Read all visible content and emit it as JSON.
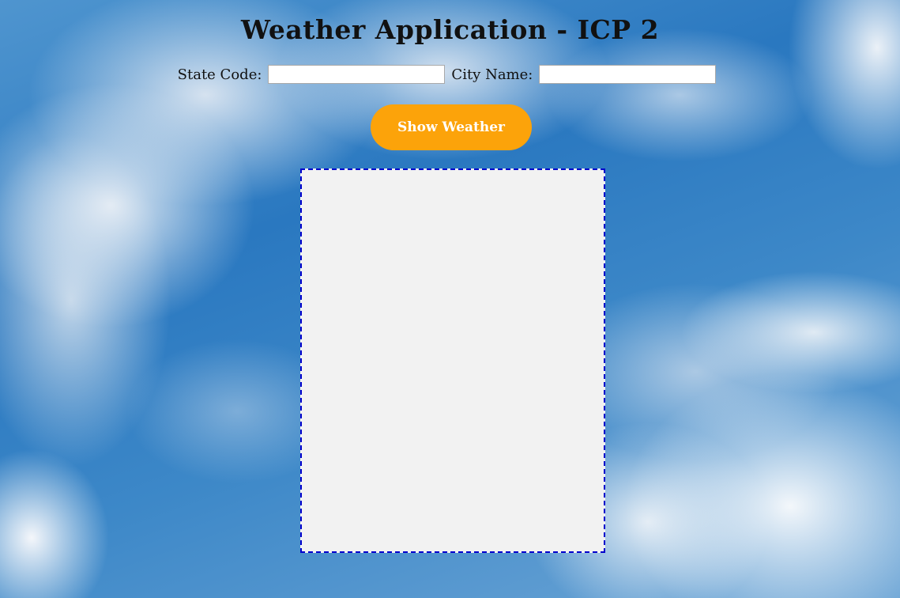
{
  "page": {
    "title": "Weather Application - ICP 2"
  },
  "form": {
    "state_label": "State Code:",
    "state_value": "",
    "city_label": "City Name:",
    "city_value": ""
  },
  "actions": {
    "show_label": "Show Weather"
  },
  "colors": {
    "button": "#fca30a",
    "panel_border": "#0000cc",
    "panel_bg": "#f2f2f2"
  }
}
